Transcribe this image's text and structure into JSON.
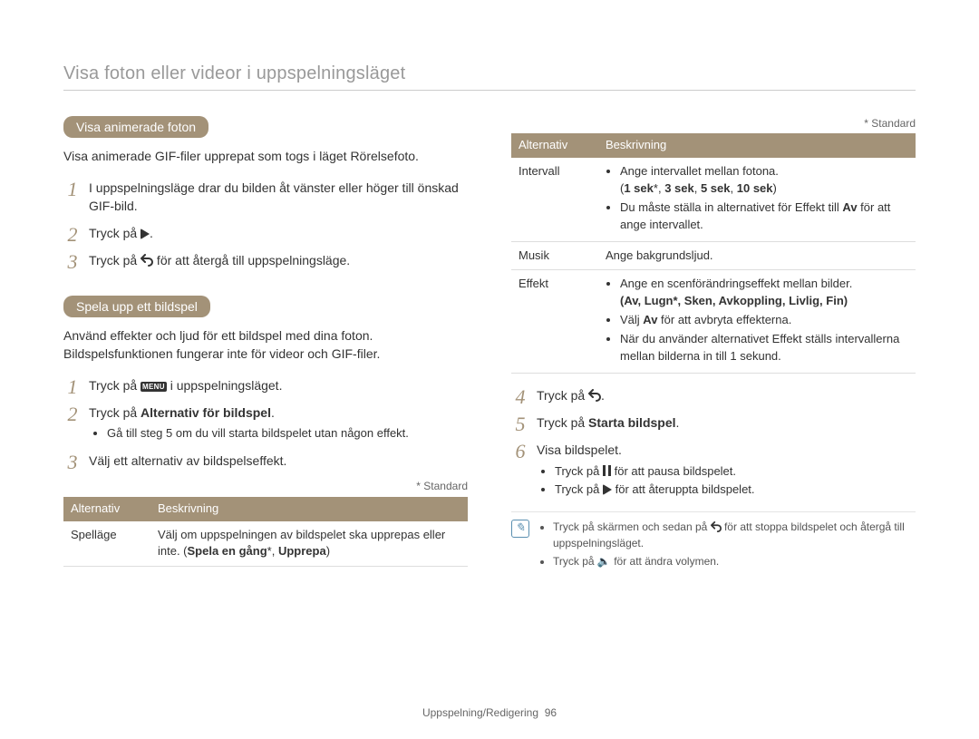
{
  "page_title": "Visa foton eller videor i uppspelningsläget",
  "footer": {
    "label": "Uppspelning/Redigering",
    "page": "96"
  },
  "left": {
    "sec1": {
      "pill": "Visa animerade foton",
      "intro": "Visa animerade GIF-filer upprepat som togs i läget Rörelsefoto.",
      "steps": {
        "s1": "I uppspelningsläge drar du bilden åt vänster eller höger till önskad GIF-bild.",
        "s2a": "Tryck på ",
        "s2b": ".",
        "s3a": "Tryck på ",
        "s3b": " för att återgå till uppspelningsläge."
      }
    },
    "sec2": {
      "pill": "Spela upp ett bildspel",
      "intro": "Använd effekter och ljud för ett bildspel med dina foton. Bildspelsfunktionen fungerar inte för videor och GIF-filer.",
      "steps": {
        "s1a": "Tryck på ",
        "s1b": " i uppspelningsläget.",
        "s2a": "Tryck på ",
        "s2b": "Alternativ för bildspel",
        "s2c": ".",
        "s2_sub": "Gå till steg 5 om du vill starta bildspelet utan någon effekt.",
        "s3": "Välj ett alternativ av bildspelseffekt."
      },
      "standard": "* Standard",
      "table": {
        "h1": "Alternativ",
        "h2": "Beskrivning",
        "r1_k": "Spelläge",
        "r1_v_a": "Välj om uppspelningen av bildspelet ska upprepas eller inte. (",
        "r1_v_b": "Spela en gång",
        "r1_v_c": "*, ",
        "r1_v_d": "Upprepa",
        "r1_v_e": ")"
      }
    }
  },
  "right": {
    "standard": "* Standard",
    "table": {
      "h1": "Alternativ",
      "h2": "Beskrivning",
      "r1_k": "Intervall",
      "r1_b1": "Ange intervallet mellan fotona.",
      "r1_b1_opts_a": "(",
      "r1_b1_opts_b": "1 sek",
      "r1_b1_opts_c": "*, ",
      "r1_b1_opts_d": "3 sek",
      "r1_b1_opts_e": ", ",
      "r1_b1_opts_f": "5 sek",
      "r1_b1_opts_g": ", ",
      "r1_b1_opts_h": "10 sek",
      "r1_b1_opts_i": ")",
      "r1_b2_a": "Du måste ställa in alternativet för Effekt till ",
      "r1_b2_b": "Av",
      "r1_b2_c": " för att ange intervallet.",
      "r2_k": "Musik",
      "r2_v": "Ange bakgrundsljud.",
      "r3_k": "Effekt",
      "r3_b1": "Ange en scenförändringseffekt mellan bilder.",
      "r3_b1_opts": "(Av, Lugn*, Sken, Avkoppling, Livlig, Fin)",
      "r3_b2_a": "Välj ",
      "r3_b2_b": "Av",
      "r3_b2_c": " för att avbryta effekterna.",
      "r3_b3": "När du använder alternativet Effekt ställs intervallerna mellan bilderna in till 1 sekund."
    },
    "steps": {
      "s4a": "Tryck på ",
      "s4b": ".",
      "s5a": "Tryck på ",
      "s5b": "Starta bildspel",
      "s5c": ".",
      "s6": "Visa bildspelet.",
      "s6_sub1_a": "Tryck på ",
      "s6_sub1_b": " för att pausa bildspelet.",
      "s6_sub2_a": "Tryck på ",
      "s6_sub2_b": " för att återuppta bildspelet."
    },
    "note": {
      "n1_a": "Tryck på skärmen och sedan på ",
      "n1_b": " för att stoppa bildspelet och återgå till uppspelningsläget.",
      "n2_a": "Tryck på ",
      "n2_b": " för att ändra volymen."
    }
  }
}
